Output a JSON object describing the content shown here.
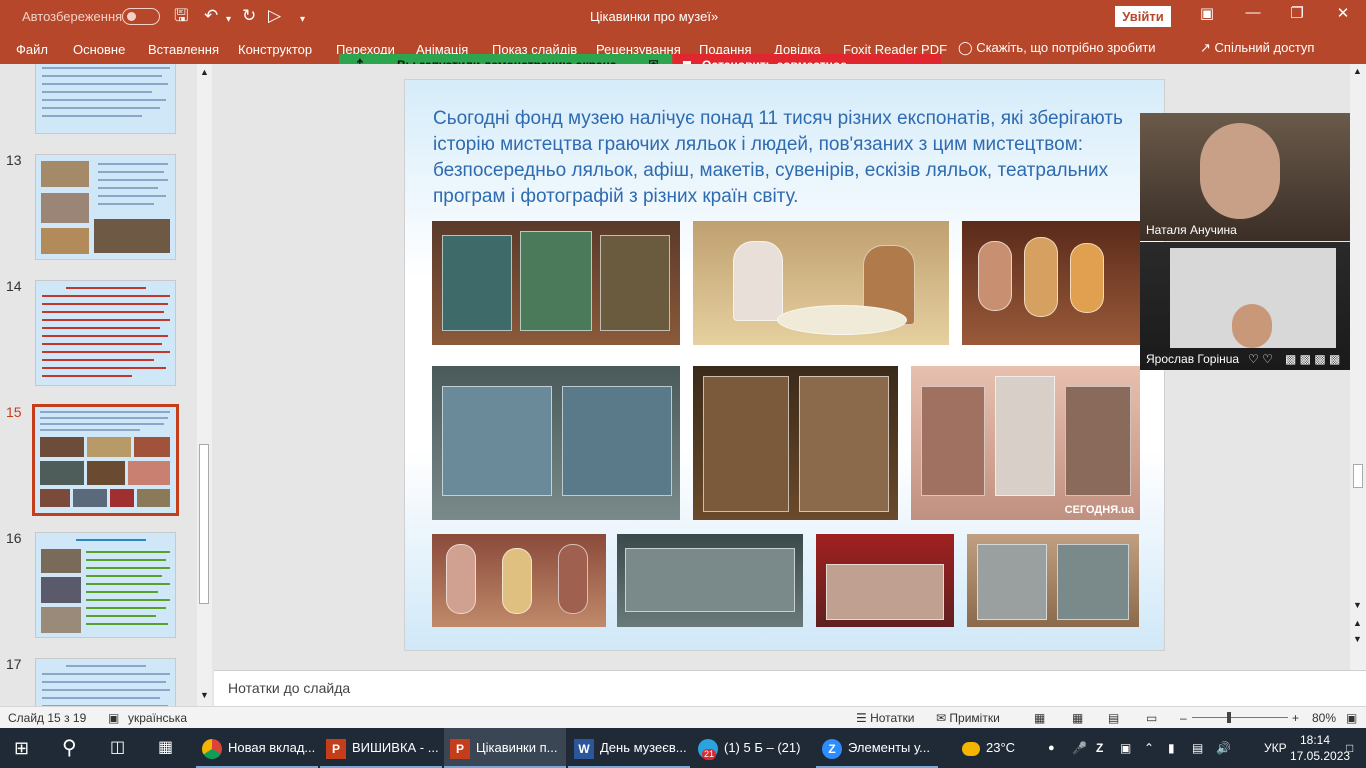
{
  "titlebar": {
    "autosave_label": "Автозбереження",
    "doc_title": "Цікавинки про музеї»",
    "signin_label": "Увійти"
  },
  "ribbon": {
    "tabs": [
      "Файл",
      "Основне",
      "Вставлення",
      "Конструктор",
      "Переходи",
      "Анімація",
      "Показ слайдів",
      "Рецензування",
      "Подання",
      "Довідка",
      "Foxit Reader PDF"
    ],
    "tell_me": "Скажіть, що потрібно зробити",
    "share": "Спільний доступ"
  },
  "sharebar": {
    "status": "Вы запустили демонстрацию экрана",
    "stop": "Остановить совместное использование",
    "status_color": "#2da44e",
    "stop_color": "#e0262f"
  },
  "thumbnails": {
    "numbers": [
      "13",
      "14",
      "15",
      "16",
      "17"
    ],
    "active": "15"
  },
  "slide": {
    "title": "Сьогодні фонд музею налічує понад 11 тисяч різних експонатів, які зберігають історію мистецтва граючих ляльок і людей, пов'язаних з цим мистецтвом: безпосередньо ляльок, афіш, макетів, сувенірів, ескізів ляльок, театральних програм і фотографій з різних країн світу.",
    "watermark": "СЕГОДНЯ.ua"
  },
  "video": {
    "participant_1": "Наталя Анучина",
    "participant_2": "Ярослав Горінuа"
  },
  "notes": {
    "placeholder": "Нотатки до слайда"
  },
  "status": {
    "slide_info": "Слайд 15 з 19",
    "language": "українська",
    "notes_btn": "Нотатки",
    "comments_btn": "Примітки",
    "zoom": "80%"
  },
  "taskbar": {
    "items": [
      "Новая вклад...",
      "ВИШИВКА - ...",
      "Цікавинки п...",
      "День музеєв...",
      "(1) 5 Б – (21)",
      "Элементы у..."
    ],
    "badge": "21",
    "weather": "23°C",
    "lang": "УКР",
    "time": "18:14",
    "date": "17.05.2023"
  }
}
